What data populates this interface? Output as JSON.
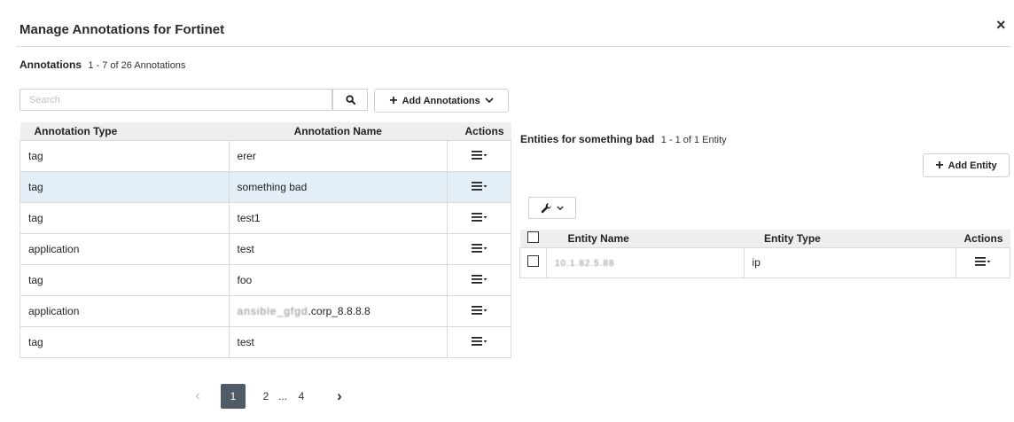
{
  "dialog": {
    "title": "Manage Annotations for Fortinet",
    "close_label": "×"
  },
  "annotations": {
    "section_label": "Annotations",
    "count_text": "1 - 7 of 26 Annotations",
    "search_placeholder": "Search",
    "search_value": "",
    "add_button_label": "Add Annotations",
    "columns": [
      "Annotation Type",
      "Annotation Name",
      "Actions"
    ],
    "rows": [
      {
        "type": "tag",
        "name": "erer",
        "selected": false
      },
      {
        "type": "tag",
        "name": "something bad",
        "selected": true
      },
      {
        "type": "tag",
        "name": "test1",
        "selected": false
      },
      {
        "type": "application",
        "name": "test",
        "selected": false
      },
      {
        "type": "tag",
        "name": "foo",
        "selected": false
      },
      {
        "type": "application",
        "name": ".corp_8.8.8.8",
        "name_redacted_prefix": "ansible_gfgd",
        "selected": false
      },
      {
        "type": "tag",
        "name": "test",
        "selected": false
      }
    ]
  },
  "pagination": {
    "prev": "‹",
    "pages": [
      "1",
      "2",
      "...",
      "4"
    ],
    "current": "1",
    "next": "›"
  },
  "entities": {
    "section_label": "Entities for something bad",
    "count_text": "1 - 1 of 1 Entity",
    "add_button_label": "Add Entity",
    "columns": [
      "Entity Name",
      "Entity Type",
      "Actions"
    ],
    "rows": [
      {
        "name_redacted": "10.1.82.5.88",
        "type": "ip"
      }
    ]
  },
  "icons": {
    "close": "close-icon",
    "search": "search-icon",
    "plus": "plus-icon",
    "chevron": "chevron-down-icon",
    "menu": "hamburger-menu-icon",
    "wrench": "wrench-icon",
    "checkbox": "checkbox-icon"
  },
  "colors": {
    "selected_row": "#e3eef6",
    "header_bg": "#eeeeee",
    "active_page": "#4f5b66"
  }
}
